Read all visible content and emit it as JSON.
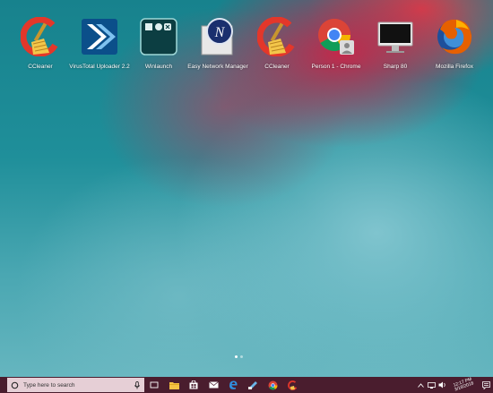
{
  "desktop": {
    "apps": [
      {
        "label": "CCleaner",
        "icon": "ccleaner-icon"
      },
      {
        "label": "VirusTotal Uploader 2.2",
        "icon": "virustotal-icon"
      },
      {
        "label": "Winlaunch",
        "icon": "winlaunch-icon"
      },
      {
        "label": "Easy Network Manager",
        "icon": "network-manager-icon"
      },
      {
        "label": "CCleaner",
        "icon": "ccleaner-icon"
      },
      {
        "label": "Person 1 - Chrome",
        "icon": "chrome-icon"
      },
      {
        "label": "Sharp 80",
        "icon": "monitor-icon"
      },
      {
        "label": "Mozilla Firefox",
        "icon": "firefox-icon"
      }
    ],
    "page_indicator": {
      "pages": 2,
      "current": 1
    }
  },
  "taskbar": {
    "search_placeholder": "Type here to search",
    "clock": {
      "time": "12:17 PM",
      "date": "3/16/2018"
    },
    "colors": {
      "taskbar": "#4a1d2e",
      "search_box": "#e6cfd6"
    }
  }
}
